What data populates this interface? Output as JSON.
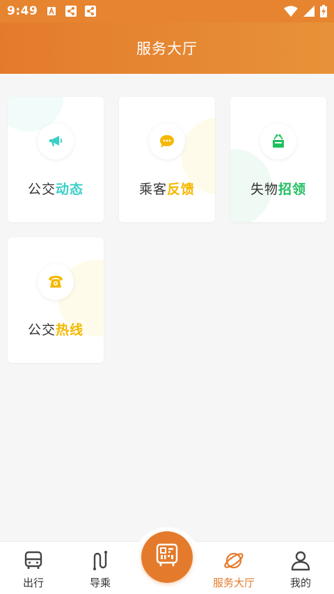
{
  "status_bar": {
    "time": "9:49",
    "icons": [
      "a-notification-icon",
      "share-icon",
      "share-icon",
      "wifi-icon",
      "signal-icon",
      "battery-charging-icon"
    ]
  },
  "header": {
    "title": "服务大厅"
  },
  "cards": [
    {
      "prefix": "公交",
      "accent": "动态",
      "accent_color": "#3ccfc7",
      "icon": "megaphone-icon"
    },
    {
      "prefix": "乘客",
      "accent": "反馈",
      "accent_color": "#f5b800",
      "icon": "chat-bubble-icon"
    },
    {
      "prefix": "失物",
      "accent": "招领",
      "accent_color": "#1fbf5f",
      "icon": "lost-box-icon"
    },
    {
      "prefix": "公交",
      "accent": "热线",
      "accent_color": "#f5b800",
      "icon": "telephone-icon"
    }
  ],
  "tabbar": {
    "tabs": [
      {
        "label": "出行",
        "icon": "bus-icon",
        "active": false
      },
      {
        "label": "导乘",
        "icon": "route-icon",
        "active": false
      },
      {
        "label": "",
        "icon": "qr-bus-code-icon",
        "active": false
      },
      {
        "label": "服务大厅",
        "icon": "planet-icon",
        "active": true
      },
      {
        "label": "我的",
        "icon": "person-icon",
        "active": false
      }
    ]
  },
  "colors": {
    "brand": "#e47b2c",
    "text": "#333333",
    "background": "#f6f6f6"
  }
}
